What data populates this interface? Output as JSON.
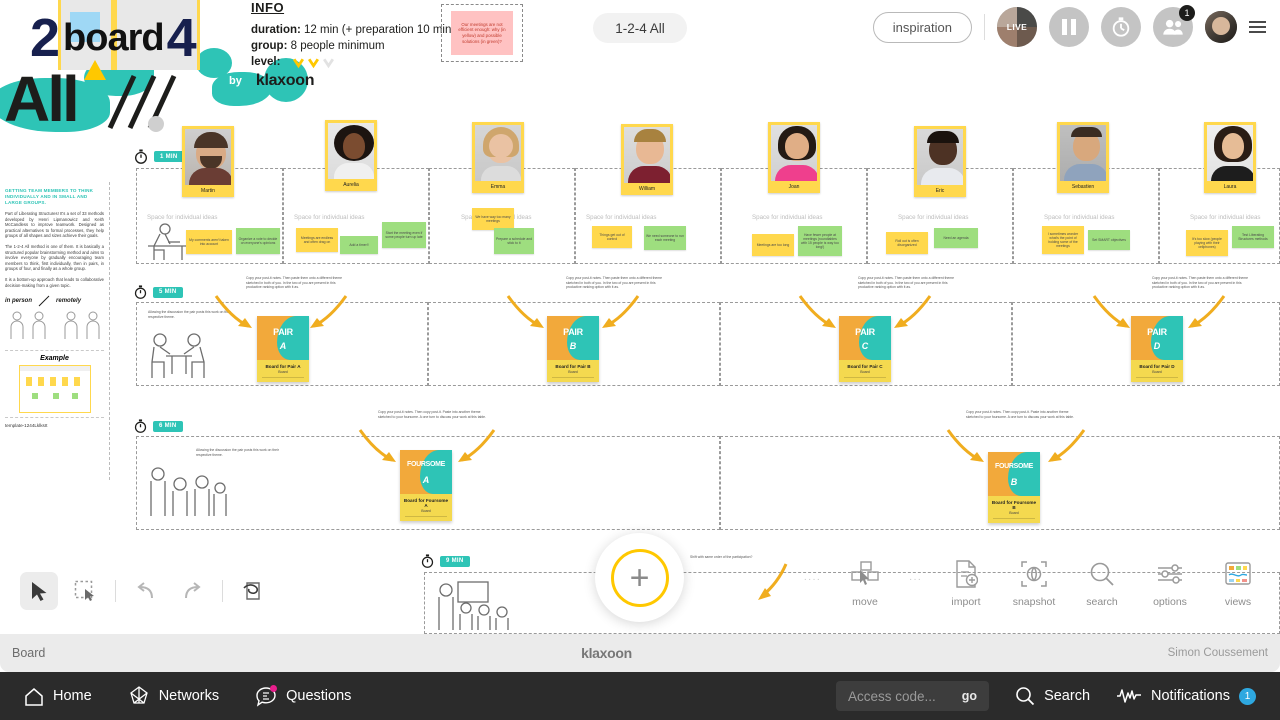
{
  "header": {
    "wordmark": {
      "num1": "2",
      "word": "board",
      "num2": "4",
      "all": "All"
    },
    "byline_pill": "by",
    "byline_name": "klaxoon",
    "info_title": "INFO",
    "info_duration_label": "duration:",
    "info_duration_value": "12 min (+ preparation 10 min)",
    "info_group_label": "group:",
    "info_group_value": "8 people minimum",
    "info_level_label": "level:",
    "pink_note": "Our meetings are not efficient enough: why (in yellow) and possible solutions (in green)?",
    "board_title": "1-2-4 All",
    "inspiration": "inspiration",
    "live_label": "LIVE",
    "participants_badge": "1"
  },
  "doc_panel": {
    "heading": "GETTING TEAM MEMBERS TO THINK INDIVIDUALLY AND IN SMALL AND LARGE GROUPS.",
    "paragraph1": "Part of Liberating Structures! It's a set of 33 methods developed by Henri Lipmanowicz and Keith McCandless to improve teamwork. Designed as practical alternatives to formal processes, they help groups of all shapes and sizes achieve their goals.",
    "paragraph2": "The 1-2-4 All method is one of them. It is basically a structured popular brainstorming method and aims to involve everyone by gradually encouraging team members to think, first individually, then in pairs, in groups of four, and finally as a whole group.",
    "paragraph3": "It is a bottom-up approach that leads to collaborative decision-making from a given topic.",
    "caption_left": "in person",
    "caption_right": "remotely",
    "example_title": "Example",
    "template_id": "template-1244LklksIt"
  },
  "rows": [
    {
      "name": "individual",
      "timer": "1 MIN",
      "zone_label": "Space for individual ideas"
    },
    {
      "name": "pairs",
      "timer": "5 MIN"
    },
    {
      "name": "foursome",
      "timer": "6 MIN"
    },
    {
      "name": "all",
      "timer": "9 MIN"
    }
  ],
  "people": [
    {
      "name": "Martin",
      "notes": [
        {
          "color": "y",
          "text": "My comments aren't taken into account"
        },
        {
          "color": "g",
          "text": "Organize a vote to decide on everyone's opinions"
        }
      ]
    },
    {
      "name": "Aurelia",
      "notes": [
        {
          "color": "y",
          "text": "Meetings are endless and often drag on"
        },
        {
          "color": "g",
          "text": "Add a timer!!"
        },
        {
          "color": "g",
          "text": "Start the meeting even if some people turn up late"
        }
      ]
    },
    {
      "name": "Emma",
      "notes": [
        {
          "color": "y",
          "text": "We have way too many meetings"
        },
        {
          "color": "g",
          "text": "Prepare a schedule and stick to it"
        }
      ]
    },
    {
      "name": "William",
      "notes": [
        {
          "color": "y",
          "text": "Things get out of control"
        },
        {
          "color": "g",
          "text": "We need someone to run each meeting"
        }
      ]
    },
    {
      "name": "Joan",
      "notes": [
        {
          "color": "y",
          "text": "Meetings are too long"
        },
        {
          "color": "g",
          "text": "Have fewer people at meetings (roundtables with 15 people is way too long!)"
        }
      ]
    },
    {
      "name": "Eric",
      "notes": [
        {
          "color": "y",
          "text": "Roll out is often disorganized"
        },
        {
          "color": "g",
          "text": "Need an agenda"
        }
      ]
    },
    {
      "name": "Sebastien",
      "notes": [
        {
          "color": "y",
          "text": "I sometimes wonder what's the point of holding some of the meetings"
        },
        {
          "color": "g",
          "text": "Set SMART objectives"
        }
      ]
    },
    {
      "name": "Laura",
      "notes": [
        {
          "color": "y",
          "text": "It's too slow (people playing with their cellphones)"
        },
        {
          "color": "g",
          "text": "Test Liberating Structures methods"
        }
      ]
    }
  ],
  "pair_boards": [
    {
      "word": "PAIR",
      "letter": "A",
      "title": "Board for Pair A",
      "sub": "Board"
    },
    {
      "word": "PAIR",
      "letter": "B",
      "title": "Board for Pair B",
      "sub": "Board"
    },
    {
      "word": "PAIR",
      "letter": "C",
      "title": "Board for Pair C",
      "sub": "Board"
    },
    {
      "word": "PAIR",
      "letter": "D",
      "title": "Board for Pair D",
      "sub": "Board"
    }
  ],
  "foursome_boards": [
    {
      "word": "FOURSOME",
      "letter": "A",
      "title": "Board for Foursome A",
      "sub": "Board"
    },
    {
      "word": "FOURSOME",
      "letter": "B",
      "title": "Board for Foursome B",
      "sub": "Board"
    }
  ],
  "instructions": {
    "pair_note": "Copy your post-it notes. Then paste them onto a different theme sketched in both of you. In the two of you are present in this productive ranking option with it as.",
    "foursome_note": "Copy your post-it notes. Then copy post-it. Paste into another theme sketched to your foursome. A one turn to discuss your work at this table.",
    "all_note": "Shift with same order of the participation?",
    "pair_side": "Allowing the discussion the pair posts this work on their respective theme."
  },
  "tools": {
    "cursor": "cursor-tool",
    "marquee": "marquee-select-tool",
    "undo": "undo",
    "redo": "redo",
    "ink": "ink-tool",
    "add": "+"
  },
  "actions": [
    {
      "icon": "move-icon",
      "label": "move"
    },
    {
      "icon": "import-icon",
      "label": "import"
    },
    {
      "icon": "snapshot-icon",
      "label": "snapshot"
    },
    {
      "icon": "search-icon",
      "label": "search"
    },
    {
      "icon": "options-icon",
      "label": "options"
    },
    {
      "icon": "views-icon",
      "label": "views"
    }
  ],
  "footer": {
    "left": "Board",
    "center": "klaxoon",
    "right": "Simon Coussement"
  },
  "navbar": {
    "home": "Home",
    "networks": "Networks",
    "questions": "Questions",
    "access_placeholder": "Access code...",
    "access_go": "go",
    "search": "Search",
    "notifications": "Notifications",
    "notifications_count": "1"
  },
  "colors": {
    "teal": "#2ec4b6",
    "yellow": "#ffd84d",
    "green": "#9ede7f",
    "orange": "#f2a93b",
    "pink": "#e91e8c",
    "blue": "#2ea8e0"
  }
}
